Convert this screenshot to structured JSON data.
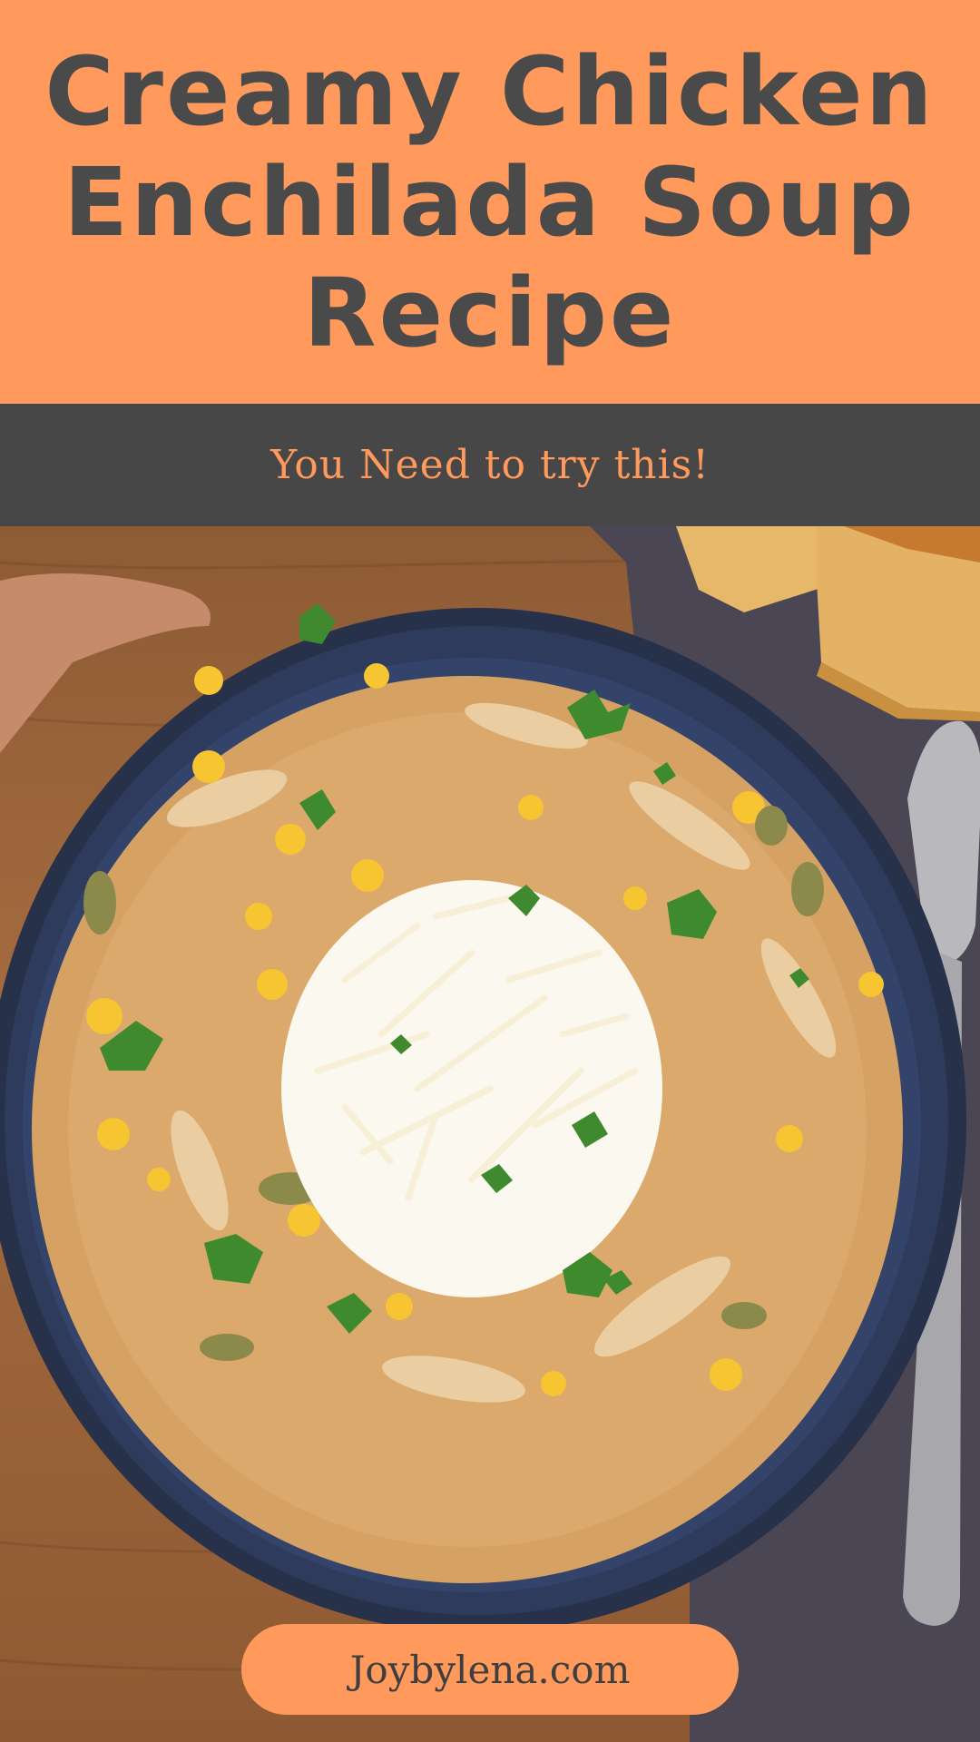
{
  "header": {
    "title": "Creamy Chicken Enchilada Soup Recipe"
  },
  "subheader": {
    "tagline": "You Need to try this!"
  },
  "footer": {
    "website": "Joybylena.com"
  },
  "colors": {
    "accent_orange": "#FF9A5C",
    "band_dark_gray": "#474747",
    "title_text": "#4a4a4a"
  }
}
